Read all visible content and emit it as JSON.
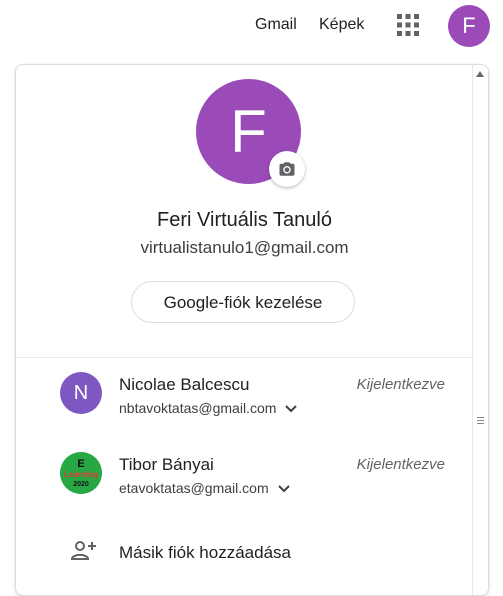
{
  "topbar": {
    "gmail_label": "Gmail",
    "images_label": "Képek",
    "apps_icon": "apps-grid-icon",
    "avatar_letter": "F"
  },
  "account_panel": {
    "avatar_letter": "F",
    "camera_icon": "camera-icon",
    "name": "Feri Virtuális Tanuló",
    "email": "virtualistanulo1@gmail.com",
    "manage_button_label": "Google-fiók kezelése"
  },
  "other_accounts": [
    {
      "avatar_letter": "N",
      "name": "Nicolae Balcescu",
      "email": "nbtavoktatas@gmail.com",
      "status": "Kijelentkezve"
    },
    {
      "avatar_logo_text": [
        "E",
        "Learning",
        "2020"
      ],
      "name": "Tibor Bányai",
      "email": "etavoktatas@gmail.com",
      "status": "Kijelentkezve"
    }
  ],
  "add_account": {
    "icon": "person-add-icon",
    "label": "Másik fiók hozzáadása"
  },
  "colors": {
    "primary_avatar": "#9a4bb8",
    "avatar_n": "#7e57c2",
    "avatar_e": "#27a844",
    "text_primary": "#202124",
    "text_secondary": "#5f6368"
  }
}
